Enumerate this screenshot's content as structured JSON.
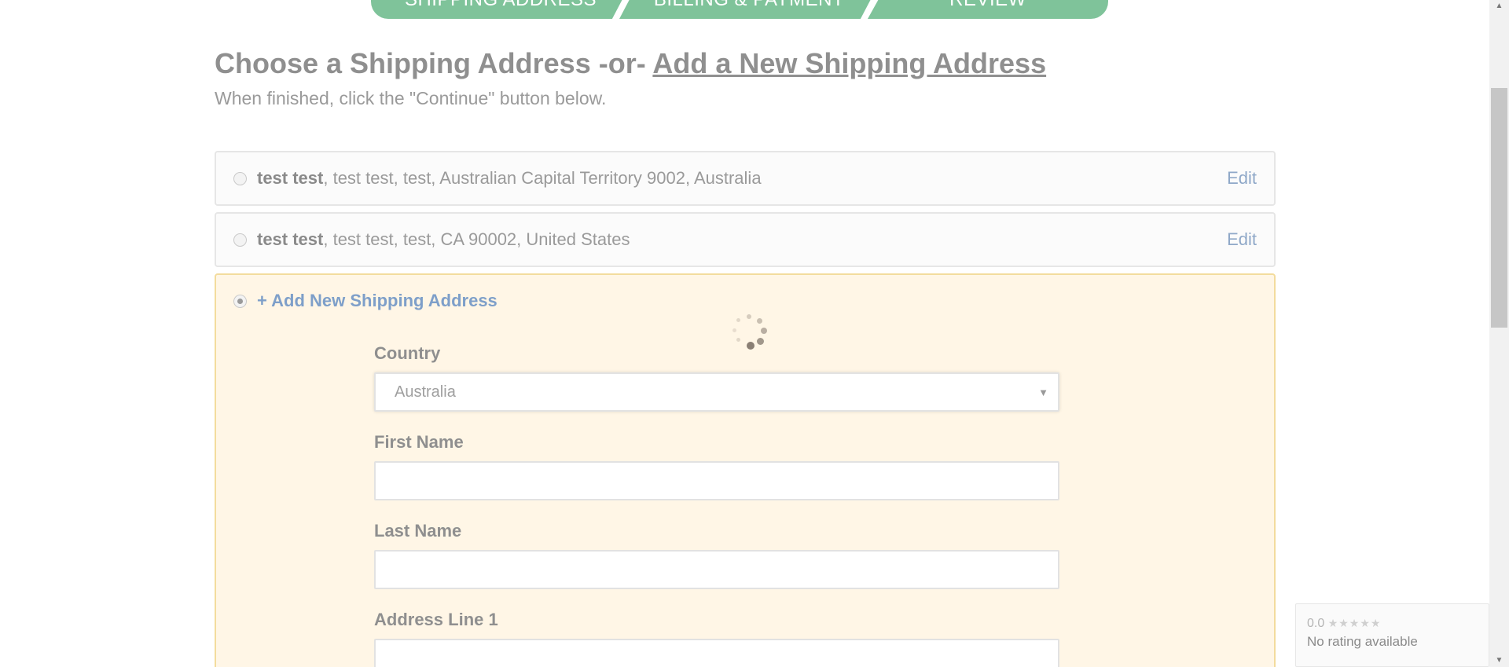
{
  "steps": [
    "SHIPPING ADDRESS",
    "BILLING & PAYMENT",
    "REVIEW"
  ],
  "heading": {
    "prefix": "Choose a Shipping Address -or- ",
    "link": "Add a New Shipping Address",
    "sub": "When finished, click the \"Continue\" button below."
  },
  "addresses": [
    {
      "name": "test test",
      "detail": ", test test, test, Australian Capital Territory 9002, Australia",
      "edit": "Edit"
    },
    {
      "name": "test test",
      "detail": ", test test, test, CA 90002, United States",
      "edit": "Edit"
    }
  ],
  "new_address": {
    "label": "+ Add New Shipping Address",
    "country_label": "Country",
    "country_value": "Australia",
    "first_name_label": "First Name",
    "last_name_label": "Last Name",
    "address1_label": "Address Line 1"
  },
  "rating_widget": {
    "score": "0.0",
    "stars": "★★★★★",
    "note": "No rating available"
  },
  "colors": {
    "step_green": "#7fc39a",
    "link_blue": "#7e9fc9",
    "panel_bg": "#fff6e6",
    "panel_border": "#f3dc9d"
  }
}
